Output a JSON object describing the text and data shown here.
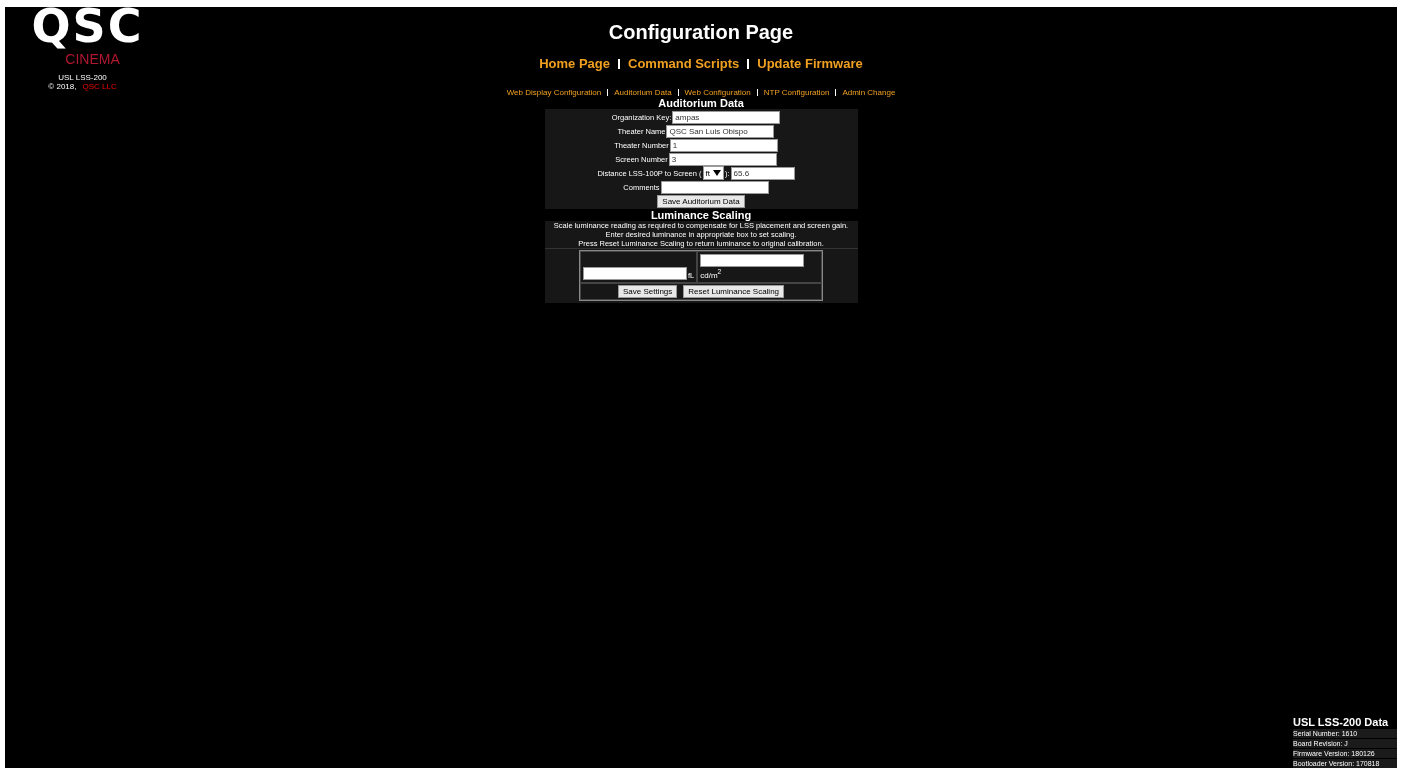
{
  "logo": {
    "mark": "QSC",
    "sub": "CINEMA",
    "model": "USL LSS-200",
    "copyright": "© 2018,",
    "company": "QSC LLC"
  },
  "title": "Configuration Page",
  "main_nav": [
    "Home Page",
    "Command Scripts",
    "Update Firmware"
  ],
  "sub_nav": [
    "Web Display Configuration",
    "Auditorium Data",
    "Web Configuration",
    "NTP Configuration",
    "Admin Change"
  ],
  "auditorium": {
    "heading": "Auditorium Data",
    "fields": [
      {
        "kind": "text",
        "label": "Organization Key:",
        "value": "ampas"
      },
      {
        "kind": "text",
        "label": "Theater Name",
        "value": "QSC San Luis Obispo"
      },
      {
        "kind": "text",
        "label": "Theater Number",
        "value": "1"
      },
      {
        "kind": "text",
        "label": "Screen Number",
        "value": "3"
      },
      {
        "kind": "unit",
        "label": "Distance LSS-100P to Screen (",
        "unit": "ft",
        "after": "):",
        "value": "65.6"
      },
      {
        "kind": "text",
        "label": "Comments"
      }
    ],
    "button": "Save Auditorium Data"
  },
  "luminance": {
    "heading": "Luminance Scaling",
    "lines": [
      "Scale luminance reading as required to compensate for LSS placement and screen gain.",
      "Enter desired luminance in appropriate box to set scaling.",
      "Press Reset Luminance Scaling to return luminance to original calibration."
    ],
    "unit_fl": "fL",
    "unit_cd": "cd/m$^{2}$",
    "buttons": [
      "Save Settings",
      "Reset Luminance Scaling"
    ]
  },
  "device": {
    "title": "USL LSS-200 Data",
    "lines": [
      "Serial Number: 1610",
      "Board Revision: J",
      "Firmware Version: 180126",
      "Bootloader Version: 170818"
    ]
  }
}
